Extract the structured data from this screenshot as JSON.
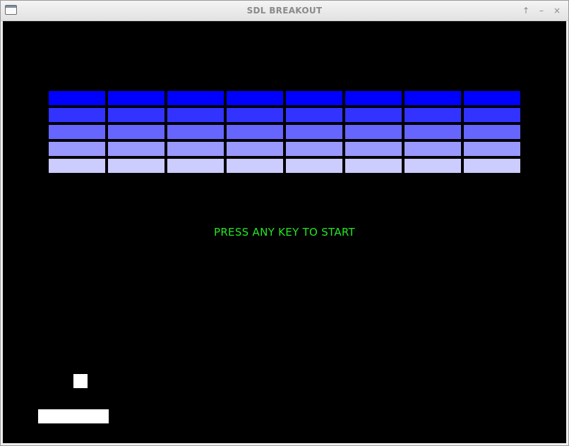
{
  "window": {
    "title": "SDL BREAKOUT",
    "buttons": {
      "maximize": "↑",
      "minimize": "–",
      "close": "×"
    }
  },
  "game": {
    "state": "waiting-to-start",
    "prompt": "PRESS ANY KEY TO START",
    "prompt_color": "#22e722",
    "background_color": "#000000",
    "brick_columns": 8,
    "brick_rows": [
      {
        "color": "#0000ff"
      },
      {
        "color": "#3333ff"
      },
      {
        "color": "#6666ff"
      },
      {
        "color": "#9999ff"
      },
      {
        "color": "#ccccff"
      }
    ],
    "ball_color": "#ffffff",
    "paddle_color": "#ffffff"
  }
}
